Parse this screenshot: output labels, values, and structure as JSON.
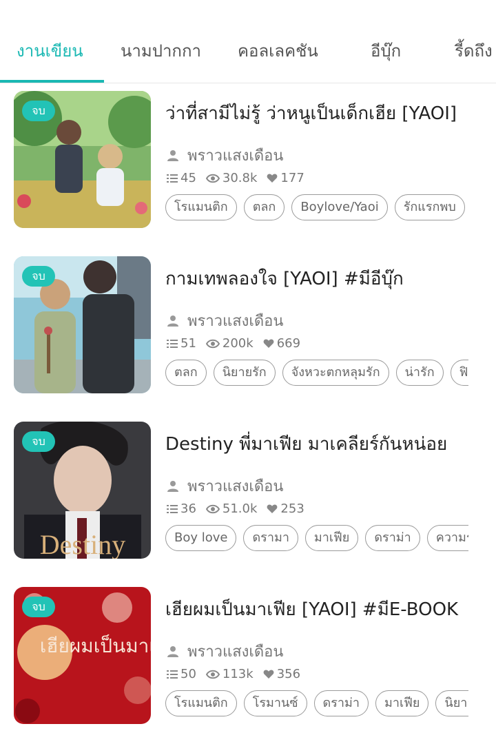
{
  "tabs": [
    {
      "label": "งานเขียน",
      "active": true
    },
    {
      "label": "นามปากกา",
      "active": false
    },
    {
      "label": "คอลเลคชัน",
      "active": false
    },
    {
      "label": "อีบุ๊ก",
      "active": false
    },
    {
      "label": "รี้ดถึง",
      "active": false
    }
  ],
  "colors": {
    "accent": "#1ab8b3",
    "badge": "#22c3b6",
    "muted": "#777777"
  },
  "stories": [
    {
      "badge": "จบ",
      "title": "ว่าที่สามีไม่รู้ ว่าหนูเป็นเด็กเฮีย [YAOI]",
      "author": "พราวแสงเดือน",
      "chapters": "45",
      "views": "30.8k",
      "likes": "177",
      "tags": [
        "โรแมนติก",
        "ตลก",
        "Boylove/Yaoi",
        "รักแรกพบ"
      ]
    },
    {
      "badge": "จบ",
      "title": "กามเทพลองใจ [YAOI] #มีอีบุ๊ก",
      "author": "พราวแสงเดือน",
      "chapters": "51",
      "views": "200k",
      "likes": "669",
      "tags": [
        "ตลก",
        "นิยายรัก",
        "จังหวะตกหลุมรัก",
        "น่ารัก",
        "ฟิน"
      ]
    },
    {
      "badge": "จบ",
      "title": "Destiny พี่มาเฟีย มาเคลียร์กันหน่อย",
      "author": "พราวแสงเดือน",
      "chapters": "36",
      "views": "51.0k",
      "likes": "253",
      "tags": [
        "Boy love",
        "ดรามา",
        "มาเฟีย",
        "ดราม่า",
        "ความรัก"
      ],
      "cover_text": "Destiny"
    },
    {
      "badge": "จบ",
      "title": "เฮียผมเป็นมาเฟีย [YAOI] #มีE-BOOK",
      "author": "พราวแสงเดือน",
      "chapters": "50",
      "views": "113k",
      "likes": "356",
      "tags": [
        "โรแมนติก",
        "โรมานซ์",
        "ดราม่า",
        "มาเฟีย",
        "นิยาย"
      ],
      "cover_text": "เฮียผมเป็นมาเฟีย"
    }
  ]
}
